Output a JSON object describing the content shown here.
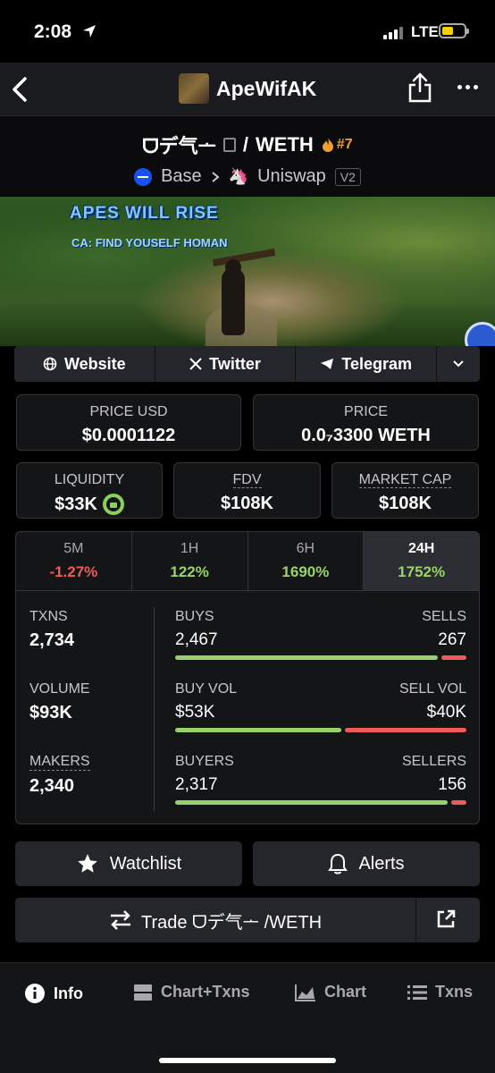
{
  "status": {
    "time": "2:08",
    "network": "LTE"
  },
  "header": {
    "title": "ApeWifAK"
  },
  "pair": {
    "base_token": "ᗜデ气ᅩ",
    "separator": "/",
    "quote_token": "WETH",
    "rank": "#7",
    "chain": "Base",
    "dex": "Uniswap",
    "version": "V2"
  },
  "banner": {
    "headline": "APES WILL RISE",
    "subline": "CA: FIND YOUSELF HOMAN"
  },
  "links": {
    "website": "Website",
    "twitter": "Twitter",
    "telegram": "Telegram"
  },
  "price": {
    "usd_label": "PRICE USD",
    "usd_value": "$0.0001122",
    "native_label": "PRICE",
    "native_value": "0.0₇3300 WETH"
  },
  "metrics": {
    "liquidity_label": "LIQUIDITY",
    "liquidity_value": "$33K",
    "fdv_label": "FDV",
    "fdv_value": "$108K",
    "mcap_label": "MARKET CAP",
    "mcap_value": "$108K"
  },
  "periods": [
    {
      "label": "5M",
      "change": "-1.27%"
    },
    {
      "label": "1H",
      "change": "122%"
    },
    {
      "label": "6H",
      "change": "1690%"
    },
    {
      "label": "24H",
      "change": "1752%"
    }
  ],
  "stats": {
    "txns_label": "TXNS",
    "txns_value": "2,734",
    "volume_label": "VOLUME",
    "volume_value": "$93K",
    "makers_label": "MAKERS",
    "makers_value": "2,340",
    "buys_label": "BUYS",
    "buys_value": "2,467",
    "sells_label": "SELLS",
    "sells_value": "267",
    "buy_vol_label": "BUY VOL",
    "buy_vol_value": "$53K",
    "sell_vol_label": "SELL VOL",
    "sell_vol_value": "$40K",
    "buyers_label": "BUYERS",
    "buyers_value": "2,317",
    "sellers_label": "SELLERS",
    "sellers_value": "156",
    "buys_fraction": 0.902,
    "buy_vol_fraction": 0.57,
    "buyers_fraction": 0.937
  },
  "actions": {
    "watchlist": "Watchlist",
    "alerts": "Alerts",
    "trade": "Trade ᗜデ气ᅩ /WETH"
  },
  "tabs": {
    "info": "Info",
    "chart_txns": "Chart+Txns",
    "chart": "Chart",
    "txns": "Txns"
  },
  "colors": {
    "positive": "#9ad26a",
    "negative": "#ee5b5b",
    "rank": "#f0a030",
    "base_chain": "#1652f0"
  }
}
